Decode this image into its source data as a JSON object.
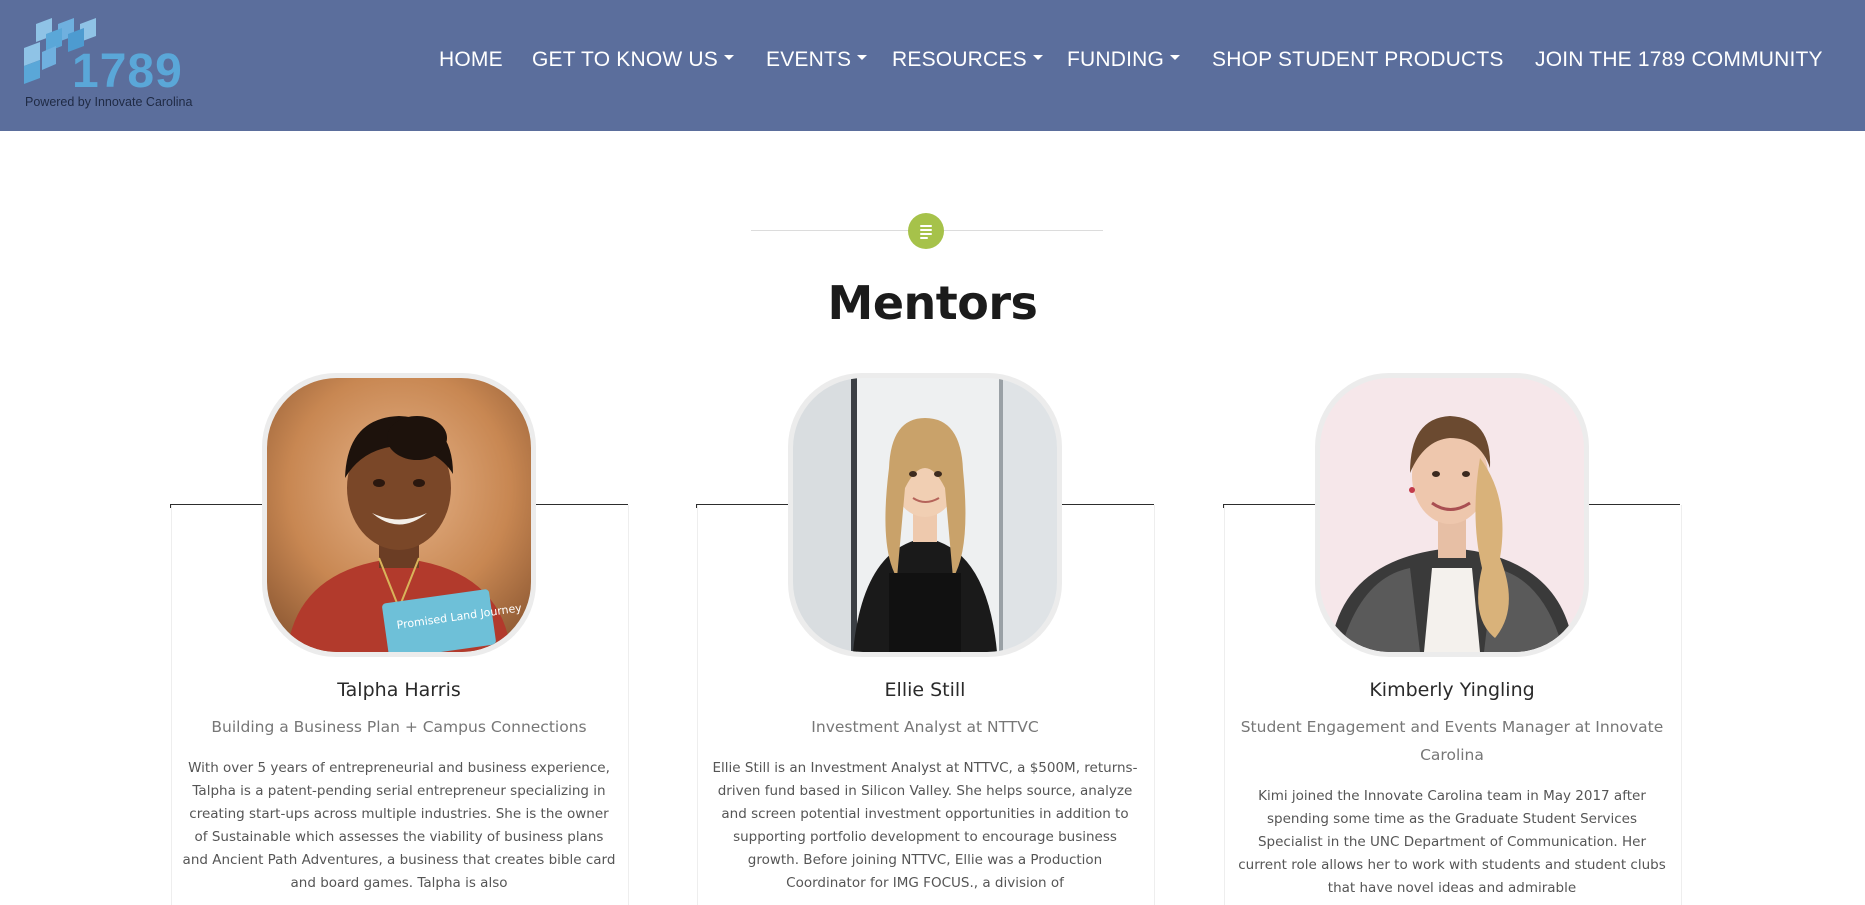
{
  "header": {
    "logo_number": "1789",
    "logo_tagline": "Powered by Innovate Carolina",
    "nav": [
      {
        "label": "HOME",
        "dropdown": false
      },
      {
        "label": "GET TO KNOW US",
        "dropdown": true
      },
      {
        "label": "EVENTS",
        "dropdown": true
      },
      {
        "label": "RESOURCES",
        "dropdown": true
      },
      {
        "label": "FUNDING",
        "dropdown": true
      },
      {
        "label": "SHOP STUDENT PRODUCTS",
        "dropdown": false
      },
      {
        "label": "JOIN THE 1789 COMMUNITY",
        "dropdown": false
      }
    ]
  },
  "section": {
    "icon": "document-lines-icon",
    "title": "Mentors"
  },
  "mentors": [
    {
      "name": "Talpha Harris",
      "role": "Building a Business Plan + Campus Connections",
      "bio": "With over 5 years of entrepreneurial and business experience, Talpha is a patent-pending serial entrepreneur specializing in creating start-ups across multiple industries. She is the owner of Sustainable which assesses the viability of business plans and Ancient Path Adventures, a business that creates bible card and board games. Talpha is also",
      "photo_book_text": "Promised Land Journey"
    },
    {
      "name": "Ellie Still",
      "role": "Investment Analyst at NTTVC",
      "bio": "Ellie Still is an Investment Analyst at NTTVC, a $500M, returns-driven fund based in Silicon Valley. She helps source, analyze and screen potential investment opportunities in addition to supporting portfolio development to encourage business growth. Before joining NTTVC, Ellie was a Production Coordinator for IMG FOCUS., a division of"
    },
    {
      "name": "Kimberly Yingling",
      "role": "Student Engagement and Events Manager at Innovate Carolina",
      "bio": "Kimi joined the Innovate Carolina team in May 2017 after spending some time as the Graduate Student Services Specialist in the UNC Department of Communication. Her current role allows her to work with students and student clubs that have novel ideas and admirable"
    }
  ],
  "colors": {
    "header_bg": "#5b6e9c",
    "logo_blue": "#5aa7d8",
    "accent_green": "#a6c24a",
    "card_topline": "#2d2d2d"
  }
}
